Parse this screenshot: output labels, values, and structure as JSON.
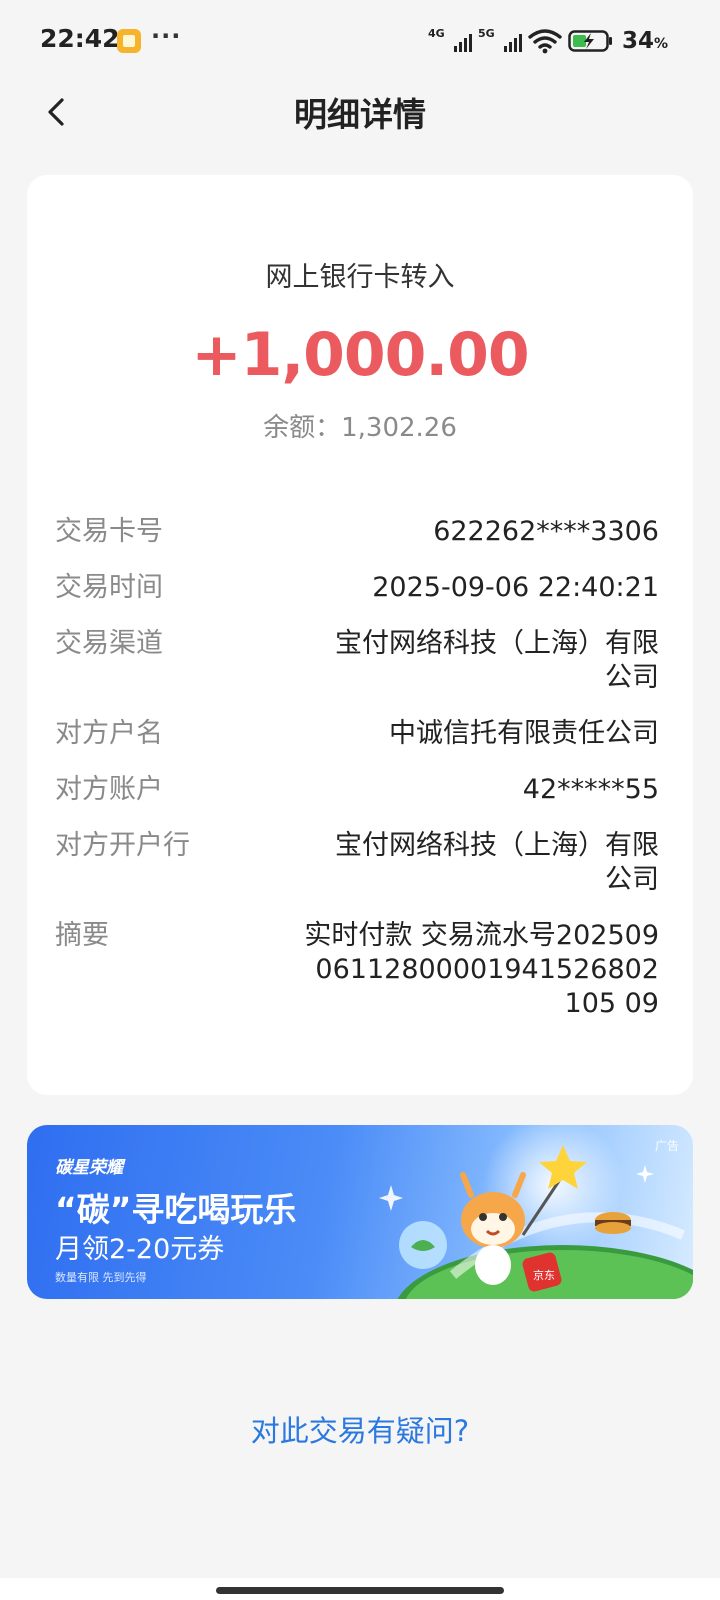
{
  "status_bar": {
    "time": "22:42",
    "more": "···",
    "signal_1": "4G",
    "signal_2": "5G",
    "battery": "34",
    "battery_unit": "%"
  },
  "nav": {
    "title": "明细详情"
  },
  "transaction": {
    "type": "网上银行卡转入",
    "amount": "+1,000.00",
    "balance": "余额：1,302.26",
    "amount_color": "#ea5a5f"
  },
  "details": [
    {
      "label": "交易卡号",
      "value": "622262****3306"
    },
    {
      "label": "交易时间",
      "value": "2025-09-06 22:40:21"
    },
    {
      "label": "交易渠道",
      "value": "宝付网络科技（上海）有限公司"
    },
    {
      "label": "对方户名",
      "value": "中诚信托有限责任公司"
    },
    {
      "label": "对方账户",
      "value": "42*****55"
    },
    {
      "label": "对方开户行",
      "value": "宝付网络科技（上海）有限公司"
    },
    {
      "label": "摘要",
      "value": "实时付款 交易流水号20250906112800001941526802105 09"
    }
  ],
  "ad": {
    "brand": "碳星荣耀",
    "headline": "“碳”寻吃喝玩乐",
    "sub": "月领2-20元券",
    "note": "数量有限 先到先得",
    "tag": "广告",
    "badge": "京东"
  },
  "question_link": "对此交易有疑问?"
}
